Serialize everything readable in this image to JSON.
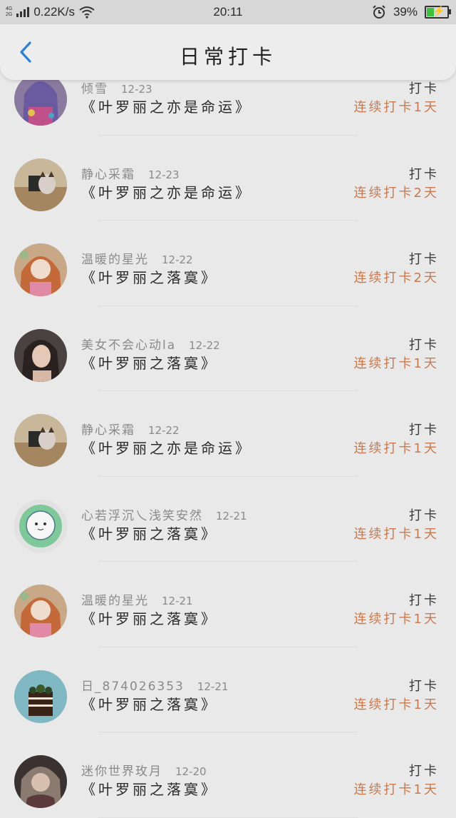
{
  "status_bar": {
    "network_top": "4G",
    "network_bottom": "2G",
    "speed": "0.22K/s",
    "time": "20:11",
    "battery": "39%",
    "battery_level": 0.39
  },
  "header": {
    "title": "日常打卡",
    "back_icon": "chevron-left-icon",
    "accent": "#2f7fd1"
  },
  "colors": {
    "streak": "#c77a50"
  },
  "checkins": [
    {
      "user": "倾雪",
      "date": "12-23",
      "book": "《叶罗丽之亦是命运》",
      "action": "打卡",
      "streak": "连续打卡1天",
      "avatar": "anime-girl-colorful"
    },
    {
      "user": "静心采霜",
      "date": "12-23",
      "book": "《叶罗丽之亦是命运》",
      "action": "打卡",
      "streak": "连续打卡2天",
      "avatar": "cat-photo"
    },
    {
      "user": "温暖的星光",
      "date": "12-22",
      "book": "《叶罗丽之落寞》",
      "action": "打卡",
      "streak": "连续打卡2天",
      "avatar": "anime-girl-pink"
    },
    {
      "user": "美女不会心动la",
      "date": "12-22",
      "book": "《叶罗丽之落寞》",
      "action": "打卡",
      "streak": "连续打卡1天",
      "avatar": "girl-photo"
    },
    {
      "user": "静心采霜",
      "date": "12-22",
      "book": "《叶罗丽之亦是命运》",
      "action": "打卡",
      "streak": "连续打卡1天",
      "avatar": "cat-photo"
    },
    {
      "user": "心若浮沉乀浅笑安然",
      "date": "12-21",
      "book": "《叶罗丽之落寞》",
      "action": "打卡",
      "streak": "连续打卡1天",
      "avatar": "sheep-cartoon"
    },
    {
      "user": "温暖的星光",
      "date": "12-21",
      "book": "《叶罗丽之落寞》",
      "action": "打卡",
      "streak": "连续打卡1天",
      "avatar": "anime-girl-pink"
    },
    {
      "user": "日_874026353",
      "date": "12-21",
      "book": "《叶罗丽之落寞》",
      "action": "打卡",
      "streak": "连续打卡1天",
      "avatar": "cake-photo"
    },
    {
      "user": "迷你世界玫月",
      "date": "12-20",
      "book": "《叶罗丽之落寞》",
      "action": "打卡",
      "streak": "连续打卡1天",
      "avatar": "anime-girl-dark"
    }
  ]
}
